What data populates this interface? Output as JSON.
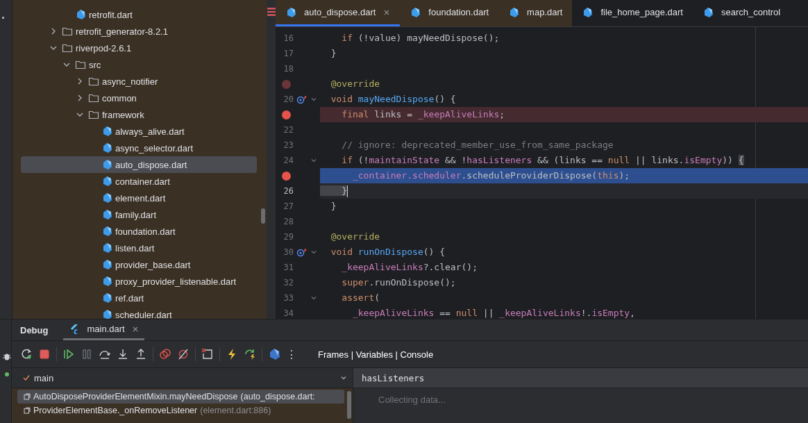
{
  "project_tree": {
    "continued_children": [
      {
        "label": "retrofit.dart",
        "kind": "dart",
        "selected": false
      }
    ],
    "items": [
      {
        "label": "retrofit_generator-8.2.1",
        "kind": "folder",
        "expanded": false,
        "selected": false
      },
      {
        "label": "riverpod-2.6.1",
        "kind": "folder",
        "expanded": true,
        "selected": false,
        "children": [
          {
            "label": "src",
            "kind": "folder",
            "expanded": true,
            "selected": false,
            "children": [
              {
                "label": "async_notifier",
                "kind": "folder",
                "expanded": false,
                "selected": false
              },
              {
                "label": "common",
                "kind": "folder",
                "expanded": false,
                "selected": false
              },
              {
                "label": "framework",
                "kind": "folder",
                "expanded": true,
                "selected": false,
                "children": [
                  {
                    "label": "always_alive.dart",
                    "kind": "dart",
                    "selected": false
                  },
                  {
                    "label": "async_selector.dart",
                    "kind": "dart",
                    "selected": false
                  },
                  {
                    "label": "auto_dispose.dart",
                    "kind": "dart",
                    "selected": true
                  },
                  {
                    "label": "container.dart",
                    "kind": "dart",
                    "selected": false
                  },
                  {
                    "label": "element.dart",
                    "kind": "dart",
                    "selected": false
                  },
                  {
                    "label": "family.dart",
                    "kind": "dart",
                    "selected": false
                  },
                  {
                    "label": "foundation.dart",
                    "kind": "dart",
                    "selected": false
                  },
                  {
                    "label": "listen.dart",
                    "kind": "dart",
                    "selected": false
                  },
                  {
                    "label": "provider_base.dart",
                    "kind": "dart",
                    "selected": false
                  },
                  {
                    "label": "proxy_provider_listenable.dart",
                    "kind": "dart",
                    "selected": false
                  },
                  {
                    "label": "ref.dart",
                    "kind": "dart",
                    "selected": false
                  },
                  {
                    "label": "scheduler.dart",
                    "kind": "dart",
                    "selected": false
                  }
                ]
              }
            ]
          }
        ]
      }
    ]
  },
  "editor": {
    "tabs": [
      {
        "label": "auto_dispose.dart",
        "selected": true,
        "tinted": true,
        "closable": true
      },
      {
        "label": "foundation.dart",
        "selected": false,
        "tinted": true
      },
      {
        "label": "map.dart",
        "selected": false,
        "tinted": true
      },
      {
        "label": "file_home_page.dart",
        "selected": false,
        "tinted": false
      },
      {
        "label": "search_control",
        "selected": false,
        "tinted": false
      }
    ],
    "lines": [
      {
        "number": "16",
        "tokens": [
          {
            "kind": "keyword",
            "text": "    if"
          },
          {
            "kind": "plain",
            "text": " (!value) mayNeedDispose();"
          }
        ]
      },
      {
        "number": "17",
        "tokens": [
          {
            "kind": "plain",
            "text": "  }"
          }
        ]
      },
      {
        "number": "18"
      },
      {
        "breakpoint": true,
        "muted": true,
        "tokens": [
          {
            "kind": "annotation",
            "text": "  @override"
          }
        ]
      },
      {
        "number": "20",
        "overridden": true,
        "fold": true,
        "tokens": [
          {
            "kind": "keyword",
            "text": "  void"
          },
          {
            "kind": "function",
            "text": " mayNeedDispose"
          },
          {
            "kind": "plain",
            "text": "() {"
          }
        ]
      },
      {
        "breakpoint": true,
        "tokens": [
          {
            "kind": "keyword",
            "text": "    final"
          },
          {
            "kind": "plain",
            "text": " links = "
          },
          {
            "kind": "field",
            "text": "_keepAliveLinks"
          },
          {
            "kind": "plain",
            "text": ";"
          }
        ]
      },
      {
        "number": "22"
      },
      {
        "number": "23",
        "tokens": [
          {
            "kind": "comment",
            "text": "    // ignore: deprecated_member_use_from_same_package"
          }
        ]
      },
      {
        "number": "24",
        "fold": true,
        "tokens": [
          {
            "kind": "keyword",
            "text": "    if"
          },
          {
            "kind": "plain",
            "text": " (!"
          },
          {
            "kind": "field",
            "text": "maintainState"
          },
          {
            "kind": "plain",
            "text": " && !"
          },
          {
            "kind": "field",
            "text": "hasListeners"
          },
          {
            "kind": "plain",
            "text": " && (links == "
          },
          {
            "kind": "keyword",
            "text": "null"
          },
          {
            "kind": "plain",
            "text": " || links."
          },
          {
            "kind": "field",
            "text": "isEmpty"
          },
          {
            "kind": "plain",
            "text": ")) "
          },
          {
            "kind": "brace",
            "text": "{"
          }
        ]
      },
      {
        "breakpoint": true,
        "execution_point": true,
        "tokens": [
          {
            "kind": "field",
            "text": "      _container"
          },
          {
            "kind": "field",
            "text": ".scheduler"
          },
          {
            "kind": "plain",
            "text": ".scheduleProviderDispose("
          },
          {
            "kind": "keyword",
            "text": "this"
          },
          {
            "kind": "plain",
            "text": ");"
          }
        ]
      },
      {
        "number": "26",
        "current_line": true,
        "tokens": [
          {
            "kind": "brace",
            "text": "    }"
          }
        ]
      },
      {
        "number": "27",
        "tokens": [
          {
            "kind": "plain",
            "text": "  }"
          }
        ]
      },
      {
        "number": "28"
      },
      {
        "number": "29",
        "tokens": [
          {
            "kind": "annotation",
            "text": "  @override"
          }
        ]
      },
      {
        "number": "30",
        "overridden": true,
        "fold": true,
        "tokens": [
          {
            "kind": "keyword",
            "text": "  void"
          },
          {
            "kind": "function",
            "text": " runOnDispose"
          },
          {
            "kind": "plain",
            "text": "() {"
          }
        ]
      },
      {
        "number": "31",
        "tokens": [
          {
            "kind": "field",
            "text": "    _keepAliveLinks"
          },
          {
            "kind": "plain",
            "text": "?.clear();"
          }
        ]
      },
      {
        "number": "32",
        "tokens": [
          {
            "kind": "keyword",
            "text": "    super"
          },
          {
            "kind": "plain",
            "text": ".runOnDispose();"
          }
        ]
      },
      {
        "number": "33",
        "fold": true,
        "tokens": [
          {
            "kind": "keyword",
            "text": "    assert"
          },
          {
            "kind": "plain",
            "text": "("
          }
        ]
      },
      {
        "number": "34",
        "tokens": [
          {
            "kind": "field",
            "text": "      _keepAliveLinks"
          },
          {
            "kind": "plain",
            "text": " == "
          },
          {
            "kind": "keyword",
            "text": "null"
          },
          {
            "kind": "plain",
            "text": " || "
          },
          {
            "kind": "field",
            "text": "_keepAliveLinks"
          },
          {
            "kind": "plain",
            "text": "!."
          },
          {
            "kind": "field",
            "text": "isEmpty"
          },
          {
            "kind": "plain",
            "text": ","
          }
        ]
      }
    ]
  },
  "debug_panel": {
    "title": "Debug",
    "tabs": [
      {
        "label": "main.dart",
        "selected": true
      }
    ],
    "toolbar_groups": [
      [
        {
          "kind": "rerun"
        },
        {
          "kind": "stop"
        }
      ],
      [
        {
          "kind": "resume"
        },
        {
          "kind": "pause"
        },
        {
          "kind": "step-over"
        },
        {
          "kind": "step-into"
        },
        {
          "kind": "step-out"
        }
      ],
      [
        {
          "kind": "breakpoints"
        },
        {
          "kind": "mute"
        }
      ],
      [
        {
          "kind": "clear"
        }
      ],
      [
        {
          "kind": "hot-reload"
        },
        {
          "kind": "hot-restart"
        }
      ],
      [
        {
          "kind": "devtools"
        },
        {
          "kind": "more",
          "label": "⋮"
        }
      ]
    ],
    "layout_label": "Frames | Variables | Console",
    "thread": "main",
    "watch": "hasListeners",
    "frames": [
      {
        "method": "AutoDisposeProviderElementMixin.mayNeedDispose",
        "location": "(auto_dispose.dart:",
        "selected": true
      },
      {
        "method": "ProviderElementBase._onRemoveListener",
        "location": "(element.dart:886)",
        "selected": false
      }
    ],
    "variables_status": "Collecting data..."
  }
}
